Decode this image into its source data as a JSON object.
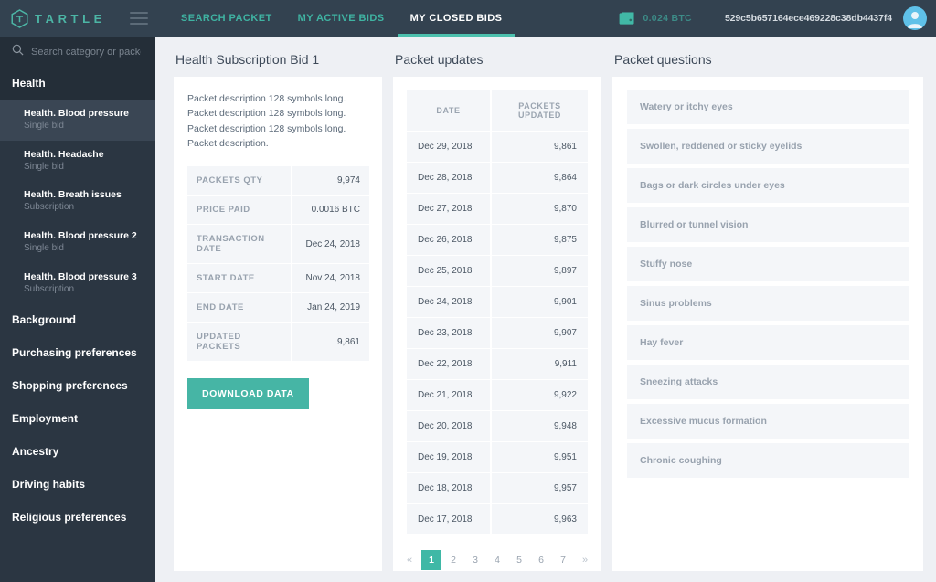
{
  "header": {
    "brand": "TARTLE",
    "menu_icon": "hamburger-icon",
    "nav": [
      {
        "label": "SEARCH PACKET",
        "active": false
      },
      {
        "label": "MY ACTIVE BIDS",
        "active": false
      },
      {
        "label": "MY CLOSED BIDS",
        "active": true
      }
    ],
    "wallet_amount": "0.024 BTC",
    "wallet_address": "529c5b657164ece469228c38db4437f4",
    "accent": "#4cc0ad",
    "bar_color": "#334250"
  },
  "sidebar": {
    "search_placeholder": "Search category or packet",
    "search_value": "",
    "category": "Health",
    "packets": [
      {
        "name": "Health. Blood pressure",
        "type": "Single bid",
        "selected": true
      },
      {
        "name": "Health. Headache",
        "type": "Single bid",
        "selected": false
      },
      {
        "name": "Health. Breath issues",
        "type": "Subscription",
        "selected": false
      },
      {
        "name": "Health. Blood pressure 2",
        "type": "Single bid",
        "selected": false
      },
      {
        "name": "Health. Blood pressure 3",
        "type": "Subscription",
        "selected": false
      }
    ],
    "categories": [
      "Background",
      "Purchasing preferences",
      "Shopping preferences",
      "Employment",
      "Ancestry",
      "Driving habits",
      "Religious preferences"
    ]
  },
  "bid": {
    "title": "Health Subscription Bid 1",
    "description": "Packet description 128 symbols long. Packet description 128 symbols long. Packet description 128 symbols long. Packet description.",
    "specs": [
      {
        "key": "PACKETS QTY",
        "value": "9,974"
      },
      {
        "key": "PRICE PAID",
        "value": "0.0016 BTC"
      },
      {
        "key": "TRANSACTION DATE",
        "value": "Dec 24, 2018"
      },
      {
        "key": "START DATE",
        "value": "Nov 24, 2018"
      },
      {
        "key": "END DATE",
        "value": "Jan 24, 2019"
      },
      {
        "key": "UPDATED PACKETS",
        "value": "9,861"
      }
    ],
    "download_label": "DOWNLOAD DATA"
  },
  "updates": {
    "title": "Packet updates",
    "columns": [
      "DATE",
      "PACKETS UPDATED"
    ],
    "rows": [
      {
        "date": "Dec 29, 2018",
        "packets": "9,861"
      },
      {
        "date": "Dec 28, 2018",
        "packets": "9,864"
      },
      {
        "date": "Dec 27, 2018",
        "packets": "9,870"
      },
      {
        "date": "Dec 26, 2018",
        "packets": "9,875"
      },
      {
        "date": "Dec 25, 2018",
        "packets": "9,897"
      },
      {
        "date": "Dec 24, 2018",
        "packets": "9,901"
      },
      {
        "date": "Dec 23, 2018",
        "packets": "9,907"
      },
      {
        "date": "Dec 22, 2018",
        "packets": "9,911"
      },
      {
        "date": "Dec 21, 2018",
        "packets": "9,922"
      },
      {
        "date": "Dec 20, 2018",
        "packets": "9,948"
      },
      {
        "date": "Dec 19, 2018",
        "packets": "9,951"
      },
      {
        "date": "Dec 18, 2018",
        "packets": "9,957"
      },
      {
        "date": "Dec 17, 2018",
        "packets": "9,963"
      }
    ],
    "pagination": {
      "prev": "«",
      "next": "»",
      "pages": [
        "1",
        "2",
        "3",
        "4",
        "5",
        "6",
        "7"
      ],
      "current": "1"
    }
  },
  "questions": {
    "title": "Packet questions",
    "items": [
      "Watery or itchy eyes",
      "Swollen, reddened or sticky eyelids",
      "Bags or dark circles under eyes",
      "Blurred or tunnel vision",
      "Stuffy nose",
      "Sinus problems",
      "Hay fever",
      "Sneezing attacks",
      "Excessive mucus formation",
      "Chronic coughing"
    ]
  }
}
